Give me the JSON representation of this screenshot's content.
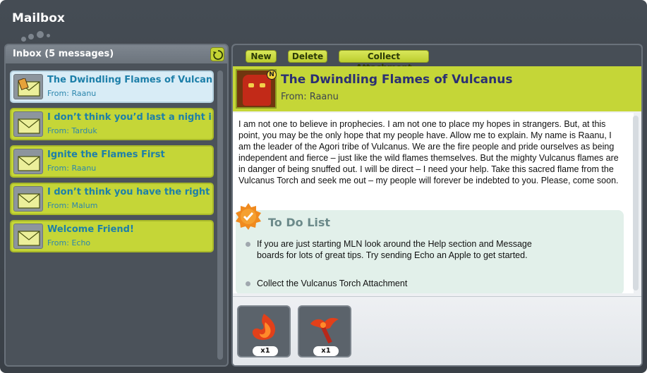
{
  "window": {
    "title": "Mailbox"
  },
  "inbox": {
    "title": "Inbox (5 messages)",
    "refresh_icon": "refresh-icon",
    "messages": [
      {
        "subject": "The Dwindling Flames of Vulcanus",
        "from": "From: Raanu",
        "selected": true,
        "icon": "envelope-icon"
      },
      {
        "subject": "I don’t think you’d last a night in th",
        "from": "From: Tarduk",
        "selected": false,
        "icon": "envelope-icon"
      },
      {
        "subject": "Ignite the Flames First",
        "from": "From: Raanu",
        "selected": false,
        "icon": "envelope-icon"
      },
      {
        "subject": "I don’t think you have the right guy",
        "from": "From: Malum",
        "selected": false,
        "icon": "envelope-icon"
      },
      {
        "subject": "Welcome Friend!",
        "from": "From: Echo",
        "selected": false,
        "icon": "envelope-icon"
      }
    ]
  },
  "toolbar": {
    "new_label": "New",
    "delete_label": "Delete",
    "collect_label": "Collect Attachment"
  },
  "message": {
    "subject": "The Dwindling Flames of Vulcanus",
    "from": "From: Raanu",
    "avatar_badge": "N",
    "body": "I am not one to believe in prophecies. I am not one to place my hopes in strangers. But, at this point, you may be the only hope that my people have. Allow me to explain. My name is Raanu, I am the leader of the Agori tribe of Vulcanus. We are the fire people and pride ourselves as being independent and fierce – just like the wild flames themselves. But the mighty Vulcanus flames are in danger of being snuffed out.  I will be direct – I need your help. Take this sacred flame from the Vulcanus Torch and seek me out – my people will forever be indebted to you. Please, come soon.",
    "todo": {
      "title": "To Do List",
      "items": [
        "If you are just starting MLN look around the Help section and Message boards for lots of great tips. Try sending Echo an Apple to get started.",
        "Collect the Vulcanus Torch Attachment"
      ]
    },
    "attachments": [
      {
        "name": "vulcanus-flame",
        "qty": "x1",
        "icon": "flame-icon"
      },
      {
        "name": "vulcanus-torch",
        "qty": "x1",
        "icon": "torch-icon"
      }
    ]
  },
  "colors": {
    "accent": "#c5d637",
    "selected": "#d8ecf6",
    "subject_text": "#2b2f73",
    "list_text": "#1d7fa9"
  }
}
